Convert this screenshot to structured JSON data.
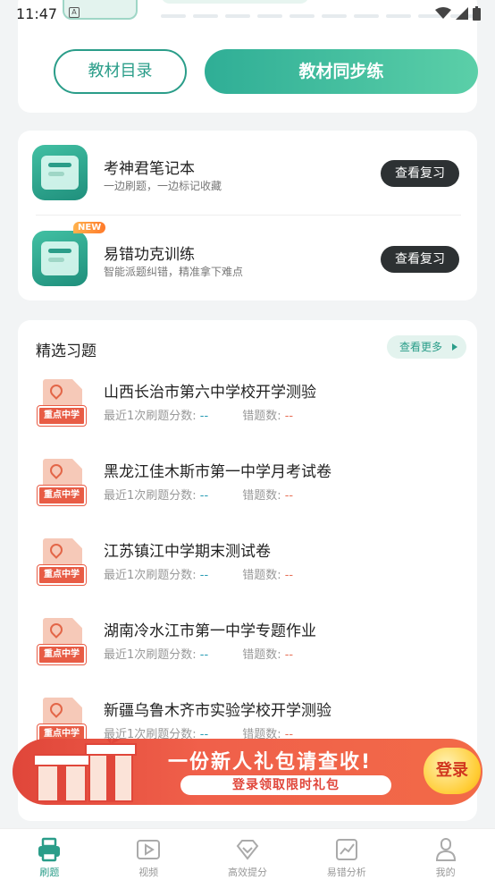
{
  "status_bar": {
    "time": "11:47",
    "sim_glyph": "A"
  },
  "top_card": {
    "catalog_button": "教材目录",
    "sync_button": "教材同步练"
  },
  "tools": [
    {
      "name": "考神君笔记本",
      "desc": "一边刷题，一边标记收藏",
      "button": "查看复习",
      "icon": "notebook-icon",
      "badge": ""
    },
    {
      "name": "易错功克训练",
      "desc": "智能派题纠错，精准拿下难点",
      "button": "查看复习",
      "icon": "training-icon",
      "badge": "NEW"
    }
  ],
  "exercises": {
    "title": "精选习题",
    "more": "查看更多",
    "score_label": "最近1次刷题分数:",
    "wrong_label": "错题数:",
    "empty_value": "--",
    "tag": "重点中学",
    "items": [
      {
        "name": "山西长治市第六中学校开学测验"
      },
      {
        "name": "黑龙江佳木斯市第一中学月考试卷"
      },
      {
        "name": "江苏镇江中学期末测试卷"
      },
      {
        "name": "湖南冷水江市第一中学专题作业"
      },
      {
        "name": "新疆乌鲁木齐市实验学校开学测验"
      }
    ]
  },
  "promo": {
    "title": "一份新人礼包请查收!",
    "subtitle": "登录领取限时礼包",
    "login": "登录"
  },
  "bottom_nav": [
    {
      "label": "刷题",
      "icon": "printer-icon",
      "active": true
    },
    {
      "label": "视频",
      "icon": "video-icon",
      "active": false
    },
    {
      "label": "高效提分",
      "icon": "diamond-icon",
      "active": false
    },
    {
      "label": "易错分析",
      "icon": "chart-icon",
      "active": false
    },
    {
      "label": "我的",
      "icon": "user-icon",
      "active": false
    }
  ],
  "colors": {
    "accent": "#2a9d89",
    "promo": "#e0463a",
    "tag": "#e85c45"
  }
}
